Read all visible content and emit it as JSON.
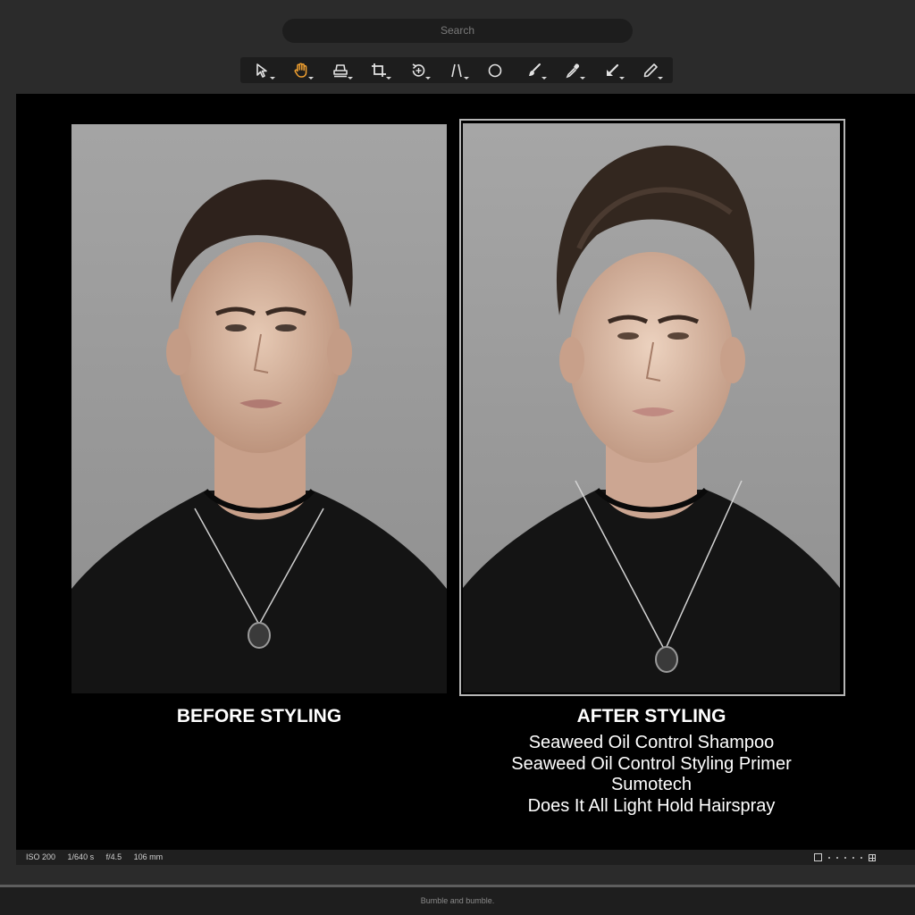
{
  "search": {
    "placeholder": "Search"
  },
  "toolbar": {
    "tools": [
      {
        "icon": "pointer-icon",
        "active": false
      },
      {
        "icon": "hand-icon",
        "active": true
      },
      {
        "icon": "stamp-icon",
        "active": false
      },
      {
        "icon": "crop-icon",
        "active": false
      },
      {
        "icon": "rotate-icon",
        "active": false
      },
      {
        "icon": "perspective-icon",
        "active": false
      },
      {
        "icon": "circle-icon",
        "active": false
      },
      {
        "icon": "brush-icon",
        "active": false
      },
      {
        "icon": "eyedropper-icon",
        "active": false
      },
      {
        "icon": "gradient-arrow-icon",
        "active": false
      },
      {
        "icon": "pencil-icon",
        "active": false
      }
    ],
    "active_color": "#f0a030"
  },
  "viewer": {
    "before_caption": "BEFORE STYLING",
    "after_caption": "AFTER STYLING",
    "products": [
      "Seaweed Oil Control Shampoo",
      "Seaweed Oil Control Styling Primer",
      "Sumotech",
      "Does It All Light Hold Hairspray"
    ]
  },
  "status": {
    "iso": "ISO 200",
    "shutter": "1/640 s",
    "aperture": "f/4.5",
    "focal_length": "106 mm"
  },
  "footer": {
    "text": "Bumble and bumble."
  }
}
